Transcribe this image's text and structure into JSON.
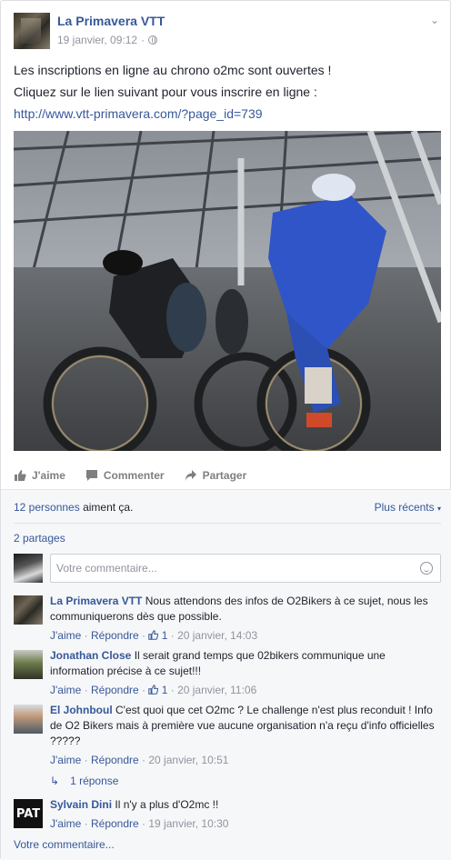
{
  "post": {
    "page_name": "La Primavera VTT",
    "timestamp": "19 janvier, 09:12",
    "text_line1": "Les inscriptions en ligne au chrono o2mc sont ouvertes !",
    "text_line2": "Cliquez sur le lien suivant pour vous inscrire en ligne :",
    "link": "http://www.vtt-primavera.com/?page_id=739"
  },
  "actions": {
    "like": "J'aime",
    "comment": "Commenter",
    "share": "Partager"
  },
  "ufi": {
    "likes_link": "12 personnes",
    "likes_rest": " aiment ça.",
    "sort": "Plus récents",
    "shares": "2 partages",
    "composer_placeholder": "Votre commentaire...",
    "view_replies": "1 réponse",
    "more_comments": "Votre commentaire..."
  },
  "comments": [
    {
      "author": "La Primavera VTT",
      "text": "Nous attendons des infos de O2Bikers à ce sujet, nous les communiquerons dès que possible.",
      "like": "J'aime",
      "reply": "Répondre",
      "likes": "1",
      "date": "20 janvier, 14:03"
    },
    {
      "author": "Jonathan Close",
      "text": "Il serait grand temps que 02bikers communique une information précise à ce sujet!!!",
      "like": "J'aime",
      "reply": "Répondre",
      "likes": "1",
      "date": "20 janvier, 11:06"
    },
    {
      "author": "El Johnboul",
      "text": "C'est quoi que cet O2mc ? Le challenge n'est plus reconduit ! Info de O2 Bikers mais à première vue aucune organisation n'a reçu d'info officielles ?????",
      "like": "J'aime",
      "reply": "Répondre",
      "date": "20 janvier, 10:51"
    },
    {
      "author": "Sylvain Dini",
      "text": "Il n'y a plus d'O2mc !!",
      "like": "J'aime",
      "reply": "Répondre",
      "date": "19 janvier, 10:30",
      "avatar_text": "PAT"
    }
  ],
  "colors": {
    "link": "#365899",
    "meta": "#90949c",
    "text": "#1d2129",
    "ufi_bg": "#f6f7f9"
  }
}
